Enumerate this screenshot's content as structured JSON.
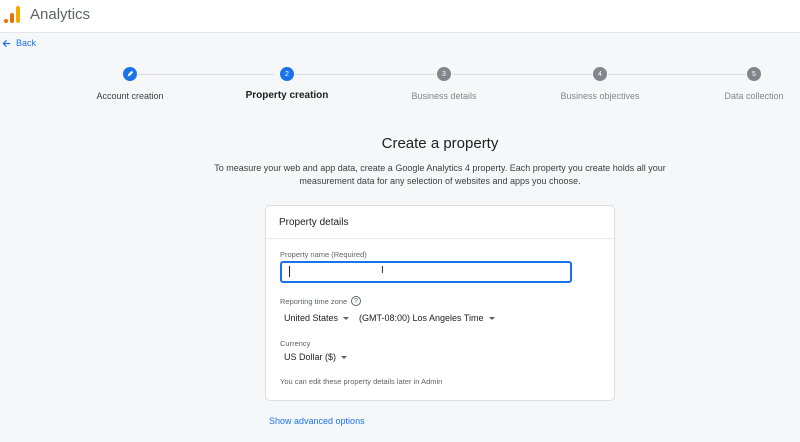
{
  "app": {
    "title": "Analytics"
  },
  "nav": {
    "back_label": "Back"
  },
  "steps": [
    {
      "number": "",
      "label": "Account creation",
      "state": "done"
    },
    {
      "number": "2",
      "label": "Property creation",
      "state": "active"
    },
    {
      "number": "3",
      "label": "Business details",
      "state": "pending"
    },
    {
      "number": "4",
      "label": "Business objectives",
      "state": "pending"
    },
    {
      "number": "5",
      "label": "Data collection",
      "state": "pending"
    }
  ],
  "main": {
    "heading": "Create a property",
    "intro": "To measure your web and app data, create a Google Analytics 4 property. Each property you create holds all your measurement data for any selection of websites and apps you choose."
  },
  "card": {
    "title": "Property details",
    "property_name_label": "Property name (Required)",
    "property_name_value": "",
    "timezone_label": "Reporting time zone",
    "country_value": "United States",
    "timezone_value": "(GMT-08:00) Los Angeles Time",
    "currency_label": "Currency",
    "currency_value": "US Dollar ($)",
    "note": "You can edit these property details later in Admin"
  },
  "advanced_link": "Show advanced options",
  "colors": {
    "accent": "#1a73e8",
    "pending_step": "#80868b",
    "logo_orange": "#e37400",
    "logo_yellow": "#f9ab00"
  },
  "icons": {
    "back": "arrow-left-icon",
    "step_done": "pencil-icon",
    "help": "question-mark-circle-icon"
  }
}
